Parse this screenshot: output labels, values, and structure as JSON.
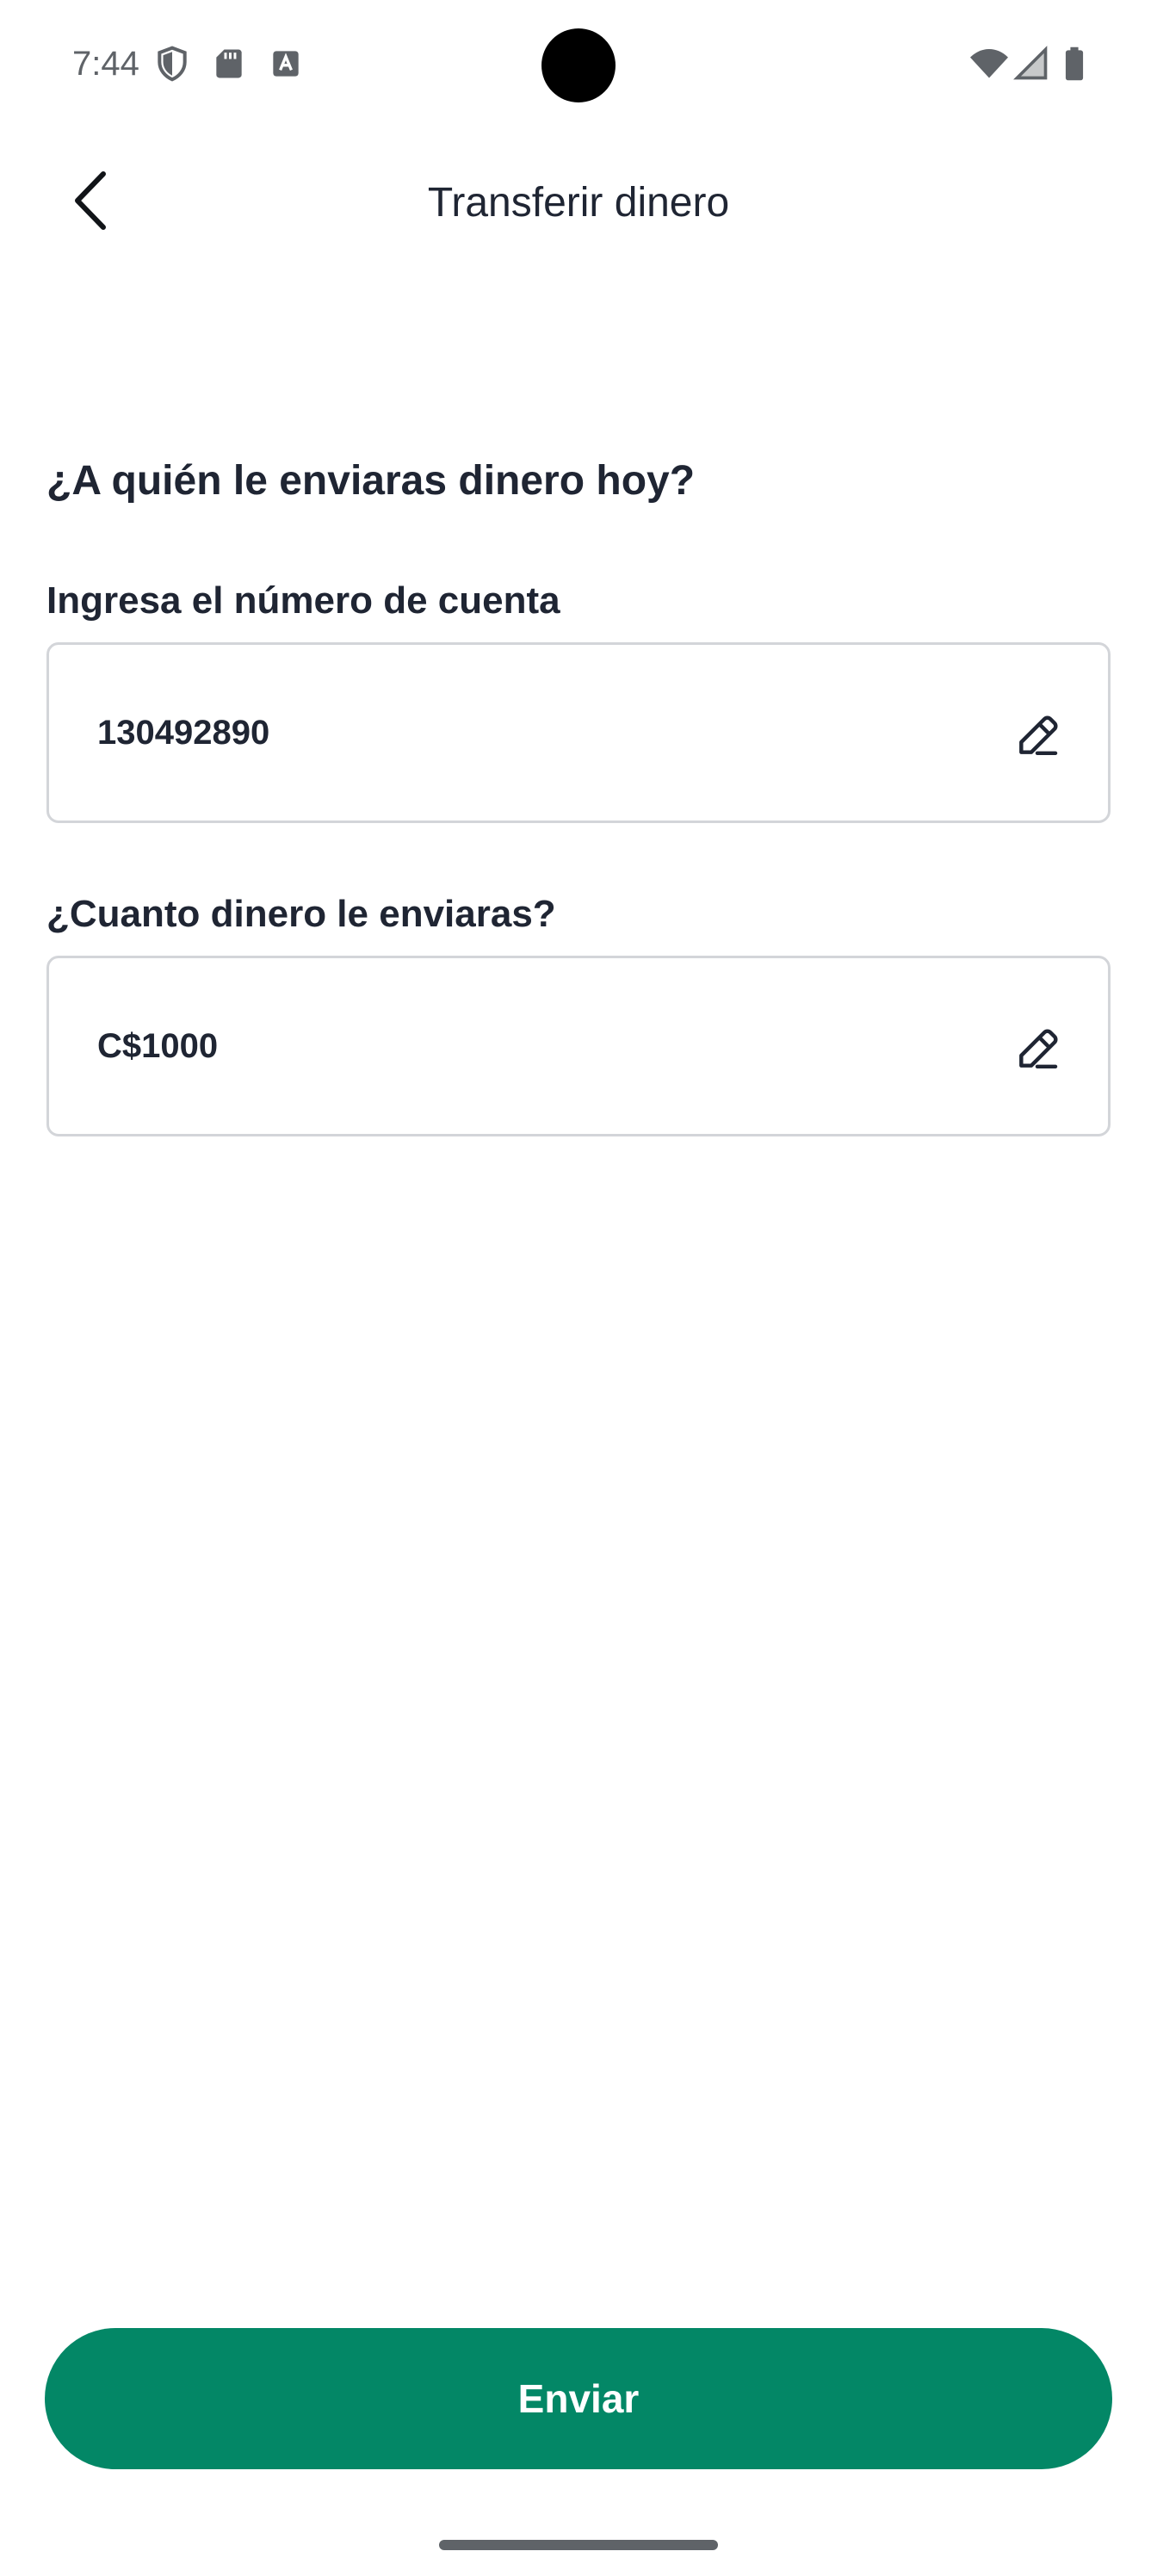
{
  "status_bar": {
    "time": "7:44",
    "left_icons": [
      "shield-icon",
      "sd-card-icon",
      "keyboard-a-icon"
    ],
    "right_icons": [
      "wifi-icon",
      "signal-icon",
      "battery-icon"
    ]
  },
  "header": {
    "title": "Transferir dinero",
    "back_icon": "chevron-left-icon"
  },
  "form": {
    "question": "¿A quién le enviaras dinero hoy?",
    "account_label": "Ingresa el número de cuenta",
    "account_value": "130492890",
    "amount_label": "¿Cuanto dinero le enviaras?",
    "amount_value": "C$1000",
    "edit_icon": "pencil-icon"
  },
  "actions": {
    "send_label": "Enviar"
  },
  "colors": {
    "accent": "#038766",
    "text": "#1f2533",
    "border": "#d3d5d9"
  }
}
